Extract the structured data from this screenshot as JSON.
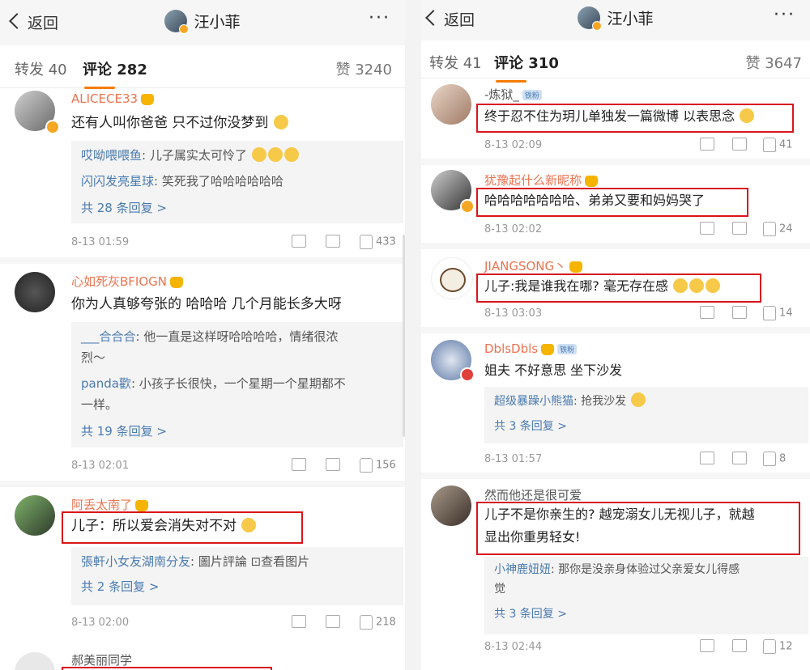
{
  "left": {
    "back_label": "返回",
    "title": "汪小菲",
    "more": "···",
    "tab_repost": "转发 40",
    "tab_comments": "评论 282",
    "likes_total": "赞 3240",
    "comments": [
      {
        "user": "ALICECE33",
        "text": "还有人叫你爸爸 只不过你没梦到",
        "replies": [
          {
            "user": "哎呦喂喂鱼",
            "text": ": 儿子属实太可怜了"
          },
          {
            "user": "闪闪发亮星球",
            "text": ": 笑死我了哈哈哈哈哈哈"
          }
        ],
        "more_replies": "共 28 条回复 >",
        "time": "8-13 01:59",
        "likes": "433"
      },
      {
        "user": "心如死灰BFIOGN",
        "text": "你为人真够夸张的 哈哈哈 几个月能长多大呀",
        "replies": [
          {
            "user": "___合合合",
            "text": ": 他一直是这样呀哈哈哈哈，情绪很浓"
          },
          {
            "user": "",
            "text": "烈～"
          },
          {
            "user": "panda歡",
            "text": ": 小孩子长很快，一个星期一个星期都不"
          },
          {
            "user": "",
            "text": "一样。"
          }
        ],
        "more_replies": "共 19 条回复 >",
        "time": "8-13 02:01",
        "likes": "156"
      },
      {
        "user": "阿丢太南了",
        "text": "儿子：所以爱会消失对不对",
        "replies": [
          {
            "user": "張軒小女友湖南分友",
            "text": ": 圖片評論 ⊡查看图片"
          }
        ],
        "more_replies": "共 2 条回复 >",
        "time": "8-13 02:00",
        "likes": "218"
      },
      {
        "user": "郝美丽同学",
        "text": ""
      }
    ]
  },
  "right": {
    "back_label": "返回",
    "title": "汪小菲",
    "more": "···",
    "tab_repost": "转发 41",
    "tab_comments": "评论 310",
    "likes_total": "赞 3647",
    "comments": [
      {
        "user": "-炼狱_",
        "text": "终于忍不住为玥儿单独发一篇微博 以表思念",
        "time": "8-13 02:09",
        "likes": "41"
      },
      {
        "user": "犹豫起什么新昵称",
        "text": "哈哈哈哈哈哈哈、弟弟又要和妈妈哭了",
        "time": "8-13 02:02",
        "likes": "24"
      },
      {
        "user": "JIANGSONG丶",
        "text": "儿子:我是谁我在哪? 毫无存在感",
        "time": "8-13 03:03",
        "likes": "14"
      },
      {
        "user": "DblsDbls",
        "text": "姐夫 不好意思 坐下沙发",
        "replies": [
          {
            "user": "超级暴躁小熊猫",
            "text": ": 抢我沙发"
          }
        ],
        "more_replies": "共 3 条回复 >",
        "time": "8-13 01:57",
        "likes": "8"
      },
      {
        "user": "然而他还是很可爱",
        "text_line1": "儿子不是你亲生的? 越宠溺女儿无视儿子，就越",
        "text_line2": "显出你重男轻女!",
        "replies": [
          {
            "user": "小神鹿妞妞",
            "text": ": 那你是没亲身体验过父亲爱女儿得感"
          },
          {
            "user": "",
            "text": "觉"
          }
        ],
        "more_replies": "共 3 条回复 >",
        "time": "8-13 02:44",
        "likes": "12"
      }
    ]
  },
  "colors": {
    "username": "#eb7350",
    "link": "#4a7ab0",
    "highlight_box": "#d8161c",
    "tab_indicator": "#f57c00"
  }
}
